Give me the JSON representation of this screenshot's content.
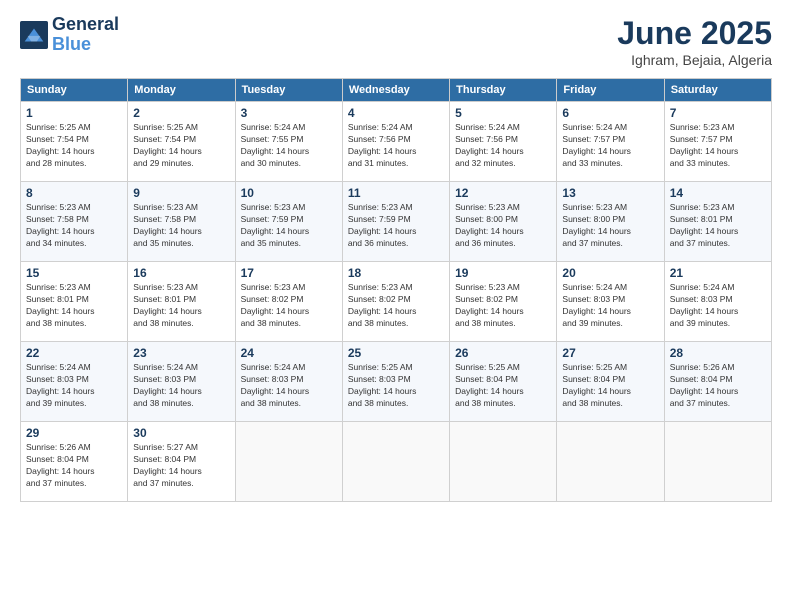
{
  "header": {
    "logo_line1": "General",
    "logo_line2": "Blue",
    "month_title": "June 2025",
    "location": "Ighram, Bejaia, Algeria"
  },
  "weekdays": [
    "Sunday",
    "Monday",
    "Tuesday",
    "Wednesday",
    "Thursday",
    "Friday",
    "Saturday"
  ],
  "weeks": [
    [
      {
        "day": "1",
        "info": "Sunrise: 5:25 AM\nSunset: 7:54 PM\nDaylight: 14 hours\nand 28 minutes."
      },
      {
        "day": "2",
        "info": "Sunrise: 5:25 AM\nSunset: 7:54 PM\nDaylight: 14 hours\nand 29 minutes."
      },
      {
        "day": "3",
        "info": "Sunrise: 5:24 AM\nSunset: 7:55 PM\nDaylight: 14 hours\nand 30 minutes."
      },
      {
        "day": "4",
        "info": "Sunrise: 5:24 AM\nSunset: 7:56 PM\nDaylight: 14 hours\nand 31 minutes."
      },
      {
        "day": "5",
        "info": "Sunrise: 5:24 AM\nSunset: 7:56 PM\nDaylight: 14 hours\nand 32 minutes."
      },
      {
        "day": "6",
        "info": "Sunrise: 5:24 AM\nSunset: 7:57 PM\nDaylight: 14 hours\nand 33 minutes."
      },
      {
        "day": "7",
        "info": "Sunrise: 5:23 AM\nSunset: 7:57 PM\nDaylight: 14 hours\nand 33 minutes."
      }
    ],
    [
      {
        "day": "8",
        "info": "Sunrise: 5:23 AM\nSunset: 7:58 PM\nDaylight: 14 hours\nand 34 minutes."
      },
      {
        "day": "9",
        "info": "Sunrise: 5:23 AM\nSunset: 7:58 PM\nDaylight: 14 hours\nand 35 minutes."
      },
      {
        "day": "10",
        "info": "Sunrise: 5:23 AM\nSunset: 7:59 PM\nDaylight: 14 hours\nand 35 minutes."
      },
      {
        "day": "11",
        "info": "Sunrise: 5:23 AM\nSunset: 7:59 PM\nDaylight: 14 hours\nand 36 minutes."
      },
      {
        "day": "12",
        "info": "Sunrise: 5:23 AM\nSunset: 8:00 PM\nDaylight: 14 hours\nand 36 minutes."
      },
      {
        "day": "13",
        "info": "Sunrise: 5:23 AM\nSunset: 8:00 PM\nDaylight: 14 hours\nand 37 minutes."
      },
      {
        "day": "14",
        "info": "Sunrise: 5:23 AM\nSunset: 8:01 PM\nDaylight: 14 hours\nand 37 minutes."
      }
    ],
    [
      {
        "day": "15",
        "info": "Sunrise: 5:23 AM\nSunset: 8:01 PM\nDaylight: 14 hours\nand 38 minutes."
      },
      {
        "day": "16",
        "info": "Sunrise: 5:23 AM\nSunset: 8:01 PM\nDaylight: 14 hours\nand 38 minutes."
      },
      {
        "day": "17",
        "info": "Sunrise: 5:23 AM\nSunset: 8:02 PM\nDaylight: 14 hours\nand 38 minutes."
      },
      {
        "day": "18",
        "info": "Sunrise: 5:23 AM\nSunset: 8:02 PM\nDaylight: 14 hours\nand 38 minutes."
      },
      {
        "day": "19",
        "info": "Sunrise: 5:23 AM\nSunset: 8:02 PM\nDaylight: 14 hours\nand 38 minutes."
      },
      {
        "day": "20",
        "info": "Sunrise: 5:24 AM\nSunset: 8:03 PM\nDaylight: 14 hours\nand 39 minutes."
      },
      {
        "day": "21",
        "info": "Sunrise: 5:24 AM\nSunset: 8:03 PM\nDaylight: 14 hours\nand 39 minutes."
      }
    ],
    [
      {
        "day": "22",
        "info": "Sunrise: 5:24 AM\nSunset: 8:03 PM\nDaylight: 14 hours\nand 39 minutes."
      },
      {
        "day": "23",
        "info": "Sunrise: 5:24 AM\nSunset: 8:03 PM\nDaylight: 14 hours\nand 38 minutes."
      },
      {
        "day": "24",
        "info": "Sunrise: 5:24 AM\nSunset: 8:03 PM\nDaylight: 14 hours\nand 38 minutes."
      },
      {
        "day": "25",
        "info": "Sunrise: 5:25 AM\nSunset: 8:03 PM\nDaylight: 14 hours\nand 38 minutes."
      },
      {
        "day": "26",
        "info": "Sunrise: 5:25 AM\nSunset: 8:04 PM\nDaylight: 14 hours\nand 38 minutes."
      },
      {
        "day": "27",
        "info": "Sunrise: 5:25 AM\nSunset: 8:04 PM\nDaylight: 14 hours\nand 38 minutes."
      },
      {
        "day": "28",
        "info": "Sunrise: 5:26 AM\nSunset: 8:04 PM\nDaylight: 14 hours\nand 37 minutes."
      }
    ],
    [
      {
        "day": "29",
        "info": "Sunrise: 5:26 AM\nSunset: 8:04 PM\nDaylight: 14 hours\nand 37 minutes."
      },
      {
        "day": "30",
        "info": "Sunrise: 5:27 AM\nSunset: 8:04 PM\nDaylight: 14 hours\nand 37 minutes."
      },
      null,
      null,
      null,
      null,
      null
    ]
  ]
}
